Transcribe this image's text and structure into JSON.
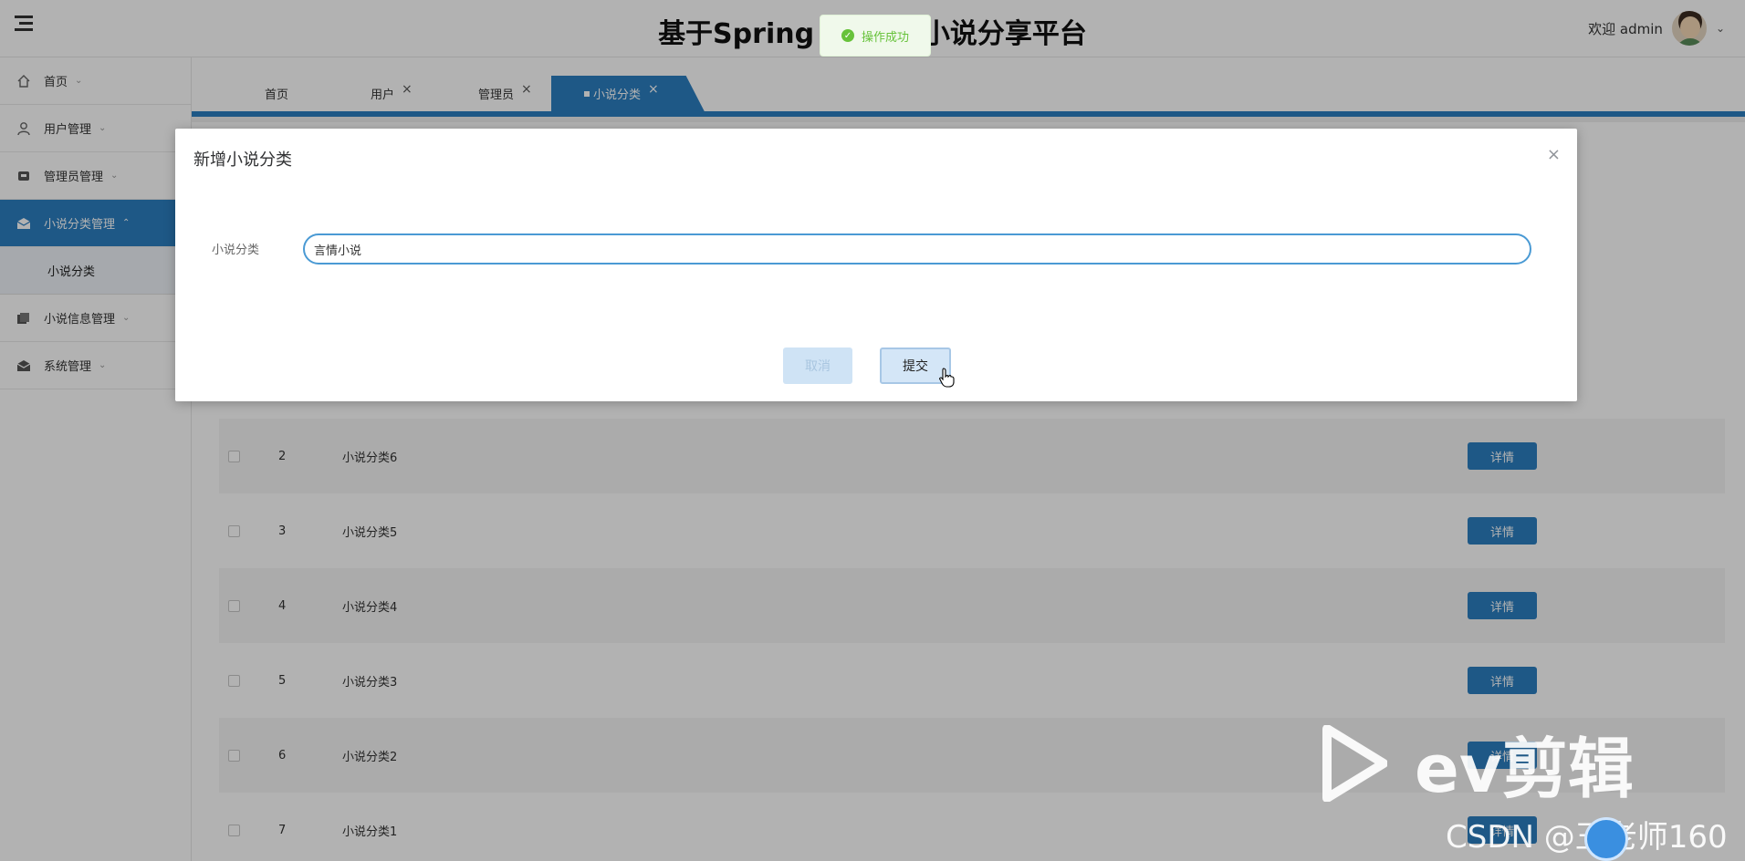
{
  "header": {
    "title": "基于Spring Boot的小说分享平台",
    "welcome": "欢迎 admin"
  },
  "sidebar": {
    "items": [
      {
        "label": "首页",
        "icon": "home-icon"
      },
      {
        "label": "用户管理",
        "icon": "user-icon"
      },
      {
        "label": "管理员管理",
        "icon": "admin-icon"
      },
      {
        "label": "小说分类管理",
        "icon": "category-icon",
        "active": true
      },
      {
        "label": "小说信息管理",
        "icon": "book-icon"
      },
      {
        "label": "系统管理",
        "icon": "system-icon"
      }
    ],
    "subitems": [
      {
        "label": "小说分类"
      }
    ]
  },
  "tabs": [
    {
      "label": "首页"
    },
    {
      "label": "用户"
    },
    {
      "label": "管理员"
    },
    {
      "label": "小说分类",
      "active": true
    }
  ],
  "table": {
    "rows": [
      {
        "index": "2",
        "name": "小说分类6",
        "action": "详情"
      },
      {
        "index": "3",
        "name": "小说分类5",
        "action": "详情"
      },
      {
        "index": "4",
        "name": "小说分类4",
        "action": "详情"
      },
      {
        "index": "5",
        "name": "小说分类3",
        "action": "详情"
      },
      {
        "index": "6",
        "name": "小说分类2",
        "action": "详情"
      },
      {
        "index": "7",
        "name": "小说分类1",
        "action": "详情"
      }
    ]
  },
  "dialog": {
    "title": "新增小说分类",
    "field_label": "小说分类",
    "field_value": "言情小说",
    "cancel_label": "取消",
    "submit_label": "提交"
  },
  "toast": {
    "message": "操作成功"
  },
  "watermark": {
    "ev_text": "ev剪辑",
    "csdn_text": "CSDN @王老师160"
  },
  "colors": {
    "primary": "#2b7ec1",
    "success": "#67c23a"
  }
}
